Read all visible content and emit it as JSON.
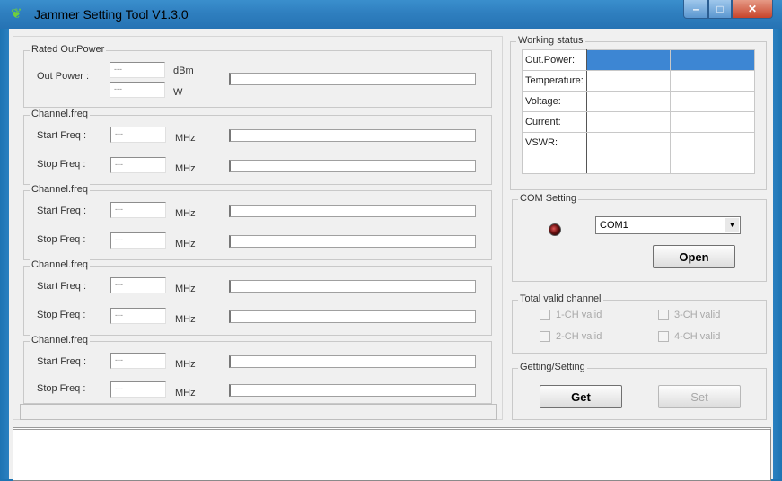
{
  "window": {
    "title": "Jammer Setting Tool V1.3.0",
    "controls": {
      "minimize": "–",
      "maximize": "□",
      "close": "✕"
    }
  },
  "rated": {
    "legend": "Rated OutPower",
    "label": "Out Power :",
    "dbm_value": "---",
    "dbm_unit": "dBm",
    "w_value": "---",
    "w_unit": "W"
  },
  "channels": [
    {
      "legend": "Channel.freq",
      "start_label": "Start Freq :",
      "start_value": "---",
      "stop_label": "Stop Freq :",
      "stop_value": "---",
      "unit": "MHz"
    },
    {
      "legend": "Channel.freq",
      "start_label": "Start Freq :",
      "start_value": "---",
      "stop_label": "Stop Freq :",
      "stop_value": "---",
      "unit": "MHz"
    },
    {
      "legend": "Channel.freq",
      "start_label": "Start Freq :",
      "start_value": "---",
      "stop_label": "Stop Freq :",
      "stop_value": "---",
      "unit": "MHz"
    },
    {
      "legend": "Channel.freq",
      "start_label": "Start Freq :",
      "start_value": "---",
      "stop_label": "Stop Freq :",
      "stop_value": "---",
      "unit": "MHz"
    }
  ],
  "working_status": {
    "legend": "Working status",
    "rows": [
      "Out.Power:",
      "Temperature:",
      "Voltage:",
      "Current:",
      "VSWR:",
      ""
    ]
  },
  "com": {
    "legend": "COM Setting",
    "port": "COM1",
    "open_label": "Open"
  },
  "valid": {
    "legend": "Total valid channel",
    "items": [
      "1-CH valid",
      "3-CH valid",
      "2-CH valid",
      "4-CH valid"
    ]
  },
  "getset": {
    "legend": "Getting/Setting",
    "get_label": "Get",
    "set_label": "Set"
  },
  "colors": {
    "titlebar": "#2f7fbf",
    "selected_row": "#3d86d3"
  }
}
